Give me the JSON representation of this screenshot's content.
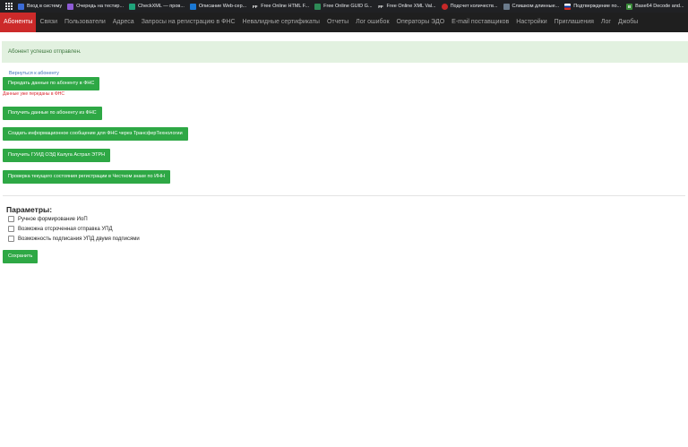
{
  "bookmarks": [
    {
      "label": "Вход в систему",
      "icon": "document-icon",
      "color": "#3b6bd6",
      "glyph": "▯"
    },
    {
      "label": "Очередь на тестир...",
      "icon": "visual-studio-icon",
      "color": "#8e5bd6",
      "glyph": "◣"
    },
    {
      "label": "CheckXML — пров...",
      "icon": "check-xml-icon",
      "color": "#1fa37a",
      "glyph": "✓"
    },
    {
      "label": "Описание Web-сер...",
      "icon": "azure-icon",
      "color": "#1a78d4",
      "glyph": "▶"
    },
    {
      "label": "Free Online HTML F...",
      "icon": "freeformatter-icon",
      "color": "#202124",
      "glyph": "FF"
    },
    {
      "label": "Free Online GUID G...",
      "icon": "guid-icon",
      "color": "#2e8b57",
      "glyph": "◆"
    },
    {
      "label": "Free Online XML Val...",
      "icon": "freeformatter-icon",
      "color": "#202124",
      "glyph": "FF"
    },
    {
      "label": "Подсчет количеств...",
      "icon": "counter-icon",
      "color": "#c62828",
      "glyph": "●"
    },
    {
      "label": "Слишком длинные...",
      "icon": "stackoverflow-icon",
      "color": "#6b7b8c",
      "glyph": "≡"
    },
    {
      "label": "Подтверждение по...",
      "icon": "russian-flag-icon",
      "color": "#d52b1e",
      "glyph": ""
    },
    {
      "label": "Base64 Decode and...",
      "icon": "base64-icon",
      "color": "#3a8c3a",
      "glyph": "B"
    }
  ],
  "nav": [
    "Абоненты",
    "Связи",
    "Пользователи",
    "Адреса",
    "Запросы на регистрацию в ФНС",
    "Невалидные сертификаты",
    "Отчеты",
    "Лог ошибок",
    "Операторы ЭДО",
    "E-mail поставщиков",
    "Настройки",
    "Приглашения",
    "Лог",
    "Джобы"
  ],
  "alert": "Абонент успешно отправлен.",
  "back_link": "Вернуться к абоненту",
  "buttons": {
    "send_fns": "Передать данные по абоненту в ФНС",
    "get_fns": "Получить данные по абоненту из ФНС",
    "create_info": "Создать информационное сообщение для ФНС через ТрансферТехнологии",
    "get_guid": "Получить ГУИД ОЭД Калуга Астрал ЭТРН",
    "check_status": "Проверка текущего состояния регистрации в Честном знаке по ИНН",
    "save": "Сохранить"
  },
  "sent_note": "Данные уже переданы в ФНС",
  "params": {
    "title": "Параметры:",
    "options": [
      "Ручное формирование ИоП",
      "Возможна отсроченная отправка УПД",
      "Возможность подписания УПД двумя подписями"
    ]
  },
  "colors": {
    "accent_active": "#cc2a2a",
    "button_green": "#2ea845",
    "alert_bg": "#e2f1e0",
    "error_red": "#d9282f"
  }
}
